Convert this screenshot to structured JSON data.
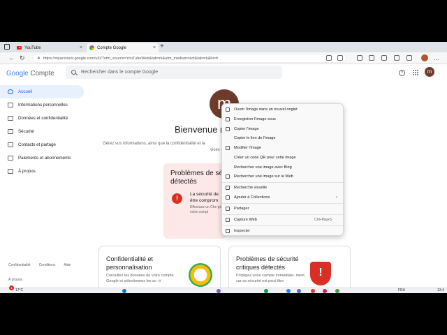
{
  "tabs": [
    {
      "label": "YouTube"
    },
    {
      "label": "Compte Google"
    }
  ],
  "address_bar": {
    "url": "https://myaccount.google.com/u/0/?utm_source=YouTubeWeb&tab=rk&utm_medium=act&tab=rk&hl=fr"
  },
  "header": {
    "logo_google": "Google",
    "logo_compte": "Compte",
    "search_placeholder": "Rechercher dans le compte Google",
    "avatar_letter": "m"
  },
  "sidebar": {
    "items": [
      {
        "label": "Accueil",
        "active": true
      },
      {
        "label": "Informations personnelles"
      },
      {
        "label": "Données et confidentialité"
      },
      {
        "label": "Sécurité"
      },
      {
        "label": "Contacts et partage"
      },
      {
        "label": "Paiements et abonnements"
      },
      {
        "label": "À propos"
      }
    ],
    "footer": [
      "Confidentialité",
      "Conditions",
      "Aide"
    ],
    "footer2": "À propos"
  },
  "main": {
    "avatar_letter": "m",
    "welcome": "Bienvenue m",
    "intro": "Gérez vos informations, ainsi que la confidentialité et la",
    "intro_tail": "vices Google.",
    "alert": {
      "title": "Problèmes de sé détectés",
      "text": "La sécurité de être comprom",
      "sub": "Effectuez un Che gérer votre compt"
    },
    "cards": [
      {
        "title": "Confidentialité et personnalisation",
        "body": "Consultez les données de votre compte Google et sélectionnez les ac- ti"
      },
      {
        "title": "Problèmes de sécurité critiques détectés",
        "body": "Protégez votre compte immédiate- ment, car sa sécurité est peut-être"
      }
    ]
  },
  "context_menu": {
    "items": [
      {
        "label": "Ouvrir l'image dans un nouvel onglet"
      },
      {
        "label": "Enregistrer l'image sous"
      },
      {
        "label": "Copier l'image"
      },
      {
        "label": "Copier le lien de l'image"
      },
      {
        "label": "Modifier l'image"
      },
      {
        "label": "Créer un code QR pour cette image"
      },
      {
        "label": "Rechercher une image avec Bing"
      },
      {
        "label": "Rechercher une image sur le Web"
      },
      {
        "label": "Recherche visuelle"
      },
      {
        "label": "Ajouter à Collections"
      },
      {
        "label": "Partager"
      },
      {
        "label": "Capture Web",
        "shortcut": "Ctrl+Maj+S"
      },
      {
        "label": "Inspecter"
      }
    ]
  },
  "taskbar": {
    "temperature": "17°C",
    "badge": "1",
    "lang": "FRA",
    "time": "13:4"
  },
  "colors": {
    "accent": "#1967d2",
    "alert_bg": "#fce8e6",
    "danger": "#d93025",
    "avatar": "#6d3b2a"
  }
}
